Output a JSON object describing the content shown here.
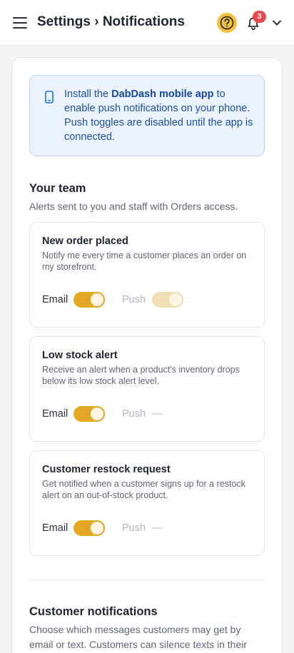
{
  "header": {
    "title": "Settings › Notifications",
    "notification_count": "3",
    "icons": {
      "menu": "hamburger-icon",
      "help": "question-circle-icon",
      "bell": "bell-icon",
      "account": "chevron-down-icon"
    },
    "colors": {
      "help_bg": "#f4c13d",
      "badge": "#e5484d"
    }
  },
  "info_banner": {
    "text_before": "Install the ",
    "app_name": "DabDash mobile app",
    "text_after": " to enable push notifications on your phone. Push toggles are disabled until the app is connected.",
    "icon": "phone-icon"
  },
  "team_section": {
    "title": "Your team",
    "description": "Alerts sent to you and staff with Orders access.",
    "cards": [
      {
        "title": "New order placed",
        "description": "Notify me every time a customer places an order on my storefront.",
        "email_label": "Email",
        "email_on": true,
        "push_label": "Push",
        "push_value": ""
      },
      {
        "title": "Low stock alert",
        "description": "Receive an alert when a product's inventory drops below its low stock alert level.",
        "email_label": "Email",
        "email_on": true,
        "push_label": "Push",
        "push_value": "—"
      },
      {
        "title": "Customer restock request",
        "description": "Get notified when a customer signs up for a restock alert on an out-of-stock product.",
        "email_label": "Email",
        "email_on": true,
        "push_label": "Push",
        "push_value": "—"
      }
    ]
  },
  "customer_section": {
    "title": "Customer notifications",
    "description": "Choose which messages customers may get by email or text. Customers can silence texts in their"
  },
  "colors": {
    "toggle_on": "#e4a625",
    "toggle_disabled": "#f1deb2",
    "info_bg": "#eaf3fe",
    "info_text": "#1f4f97"
  }
}
